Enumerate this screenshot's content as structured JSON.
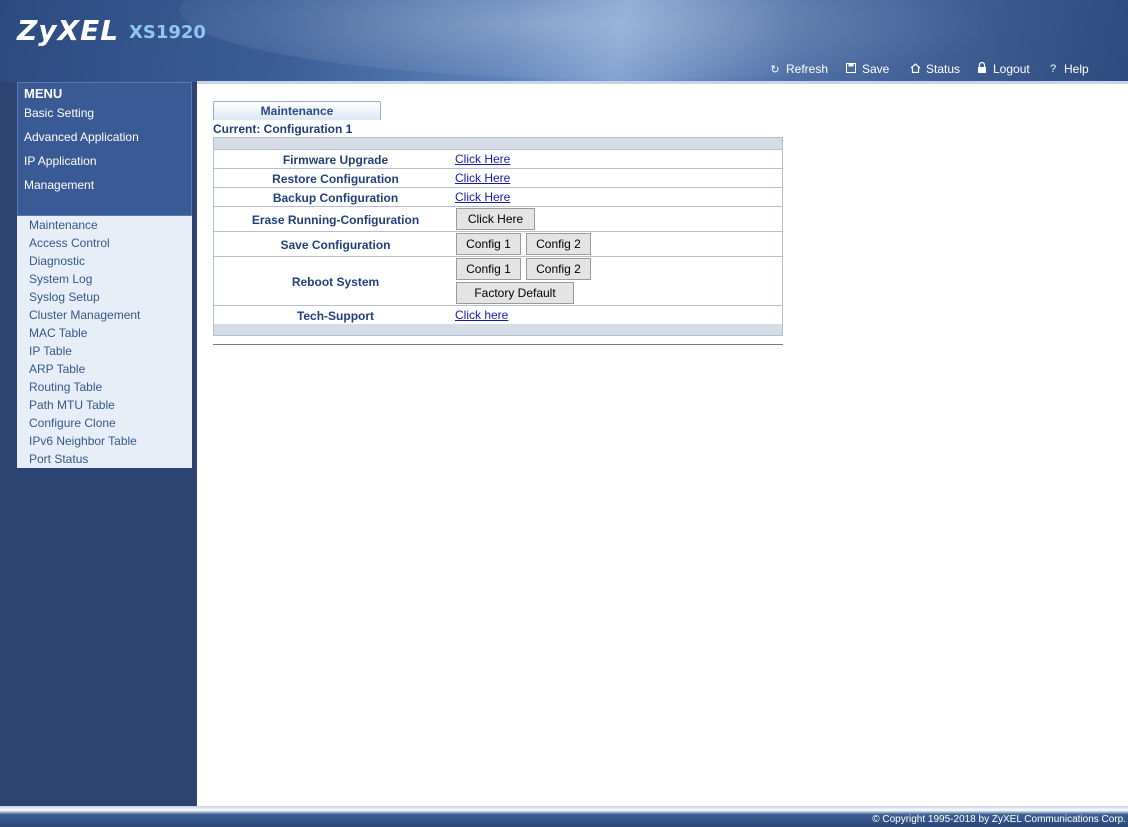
{
  "header": {
    "brand": "ZyXEL",
    "model": "XS1920",
    "toolbar": [
      {
        "label": "Refresh",
        "icon": "refresh-icon"
      },
      {
        "label": "Save",
        "icon": "save-icon"
      },
      {
        "label": "Status",
        "icon": "home-icon"
      },
      {
        "label": "Logout",
        "icon": "lock-icon"
      },
      {
        "label": "Help",
        "icon": "help-icon"
      }
    ]
  },
  "menu": {
    "title": "MENU",
    "items": [
      "Basic Setting",
      "Advanced Application",
      "IP Application",
      "Management"
    ],
    "submenu": [
      "Maintenance",
      "Access Control",
      "Diagnostic",
      "System Log",
      "Syslog Setup",
      "Cluster Management",
      "MAC Table",
      "IP Table",
      "ARP Table",
      "Routing Table",
      "Path MTU Table",
      "Configure Clone",
      "IPv6 Neighbor Table",
      "Port Status"
    ]
  },
  "content": {
    "tab": "Maintenance",
    "current": "Current: Configuration 1",
    "rows": {
      "firmware": {
        "label": "Firmware Upgrade",
        "link": "Click Here"
      },
      "restore": {
        "label": "Restore Configuration",
        "link": "Click Here"
      },
      "backup": {
        "label": "Backup Configuration",
        "link": "Click Here"
      },
      "erase": {
        "label": "Erase Running-Configuration",
        "button": "Click Here"
      },
      "save": {
        "label": "Save Configuration",
        "button1": "Config 1",
        "button2": "Config 2"
      },
      "reboot": {
        "label": "Reboot System",
        "button1": "Config 1",
        "button2": "Config 2",
        "button3": "Factory Default"
      },
      "techsupport": {
        "label": "Tech-Support",
        "link": "Click here"
      }
    }
  },
  "footer": {
    "copyright": "© Copyright 1995-2018 by ZyXEL Communications Corp."
  }
}
